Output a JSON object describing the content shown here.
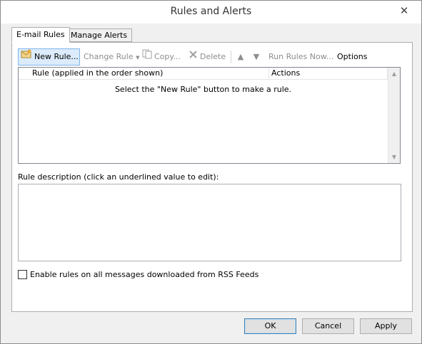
{
  "window": {
    "title": "Rules and Alerts",
    "close_label": "✕"
  },
  "tabs": [
    {
      "label": "E-mail Rules"
    },
    {
      "label": "Manage Alerts"
    }
  ],
  "toolbar": {
    "new_rule": "New Rule...",
    "change_rule": "Change Rule",
    "copy": "Copy...",
    "delete": "Delete",
    "run_rules_now": "Run Rules Now...",
    "options": "Options"
  },
  "rules_list": {
    "columns": [
      "Rule (applied in the order shown)",
      "Actions"
    ],
    "empty_message": "Select the \"New Rule\" button to make a rule."
  },
  "description": {
    "label": "Rule description (click an underlined value to edit):"
  },
  "rss": {
    "label": "Enable rules on all messages downloaded from RSS Feeds",
    "checked": false
  },
  "buttons": {
    "ok": "OK",
    "cancel": "Cancel",
    "apply": "Apply"
  },
  "colors": {
    "hover_fill": "#dcecfc",
    "hover_border": "#7eb4ea",
    "disabled_text": "#8d8d8d"
  }
}
